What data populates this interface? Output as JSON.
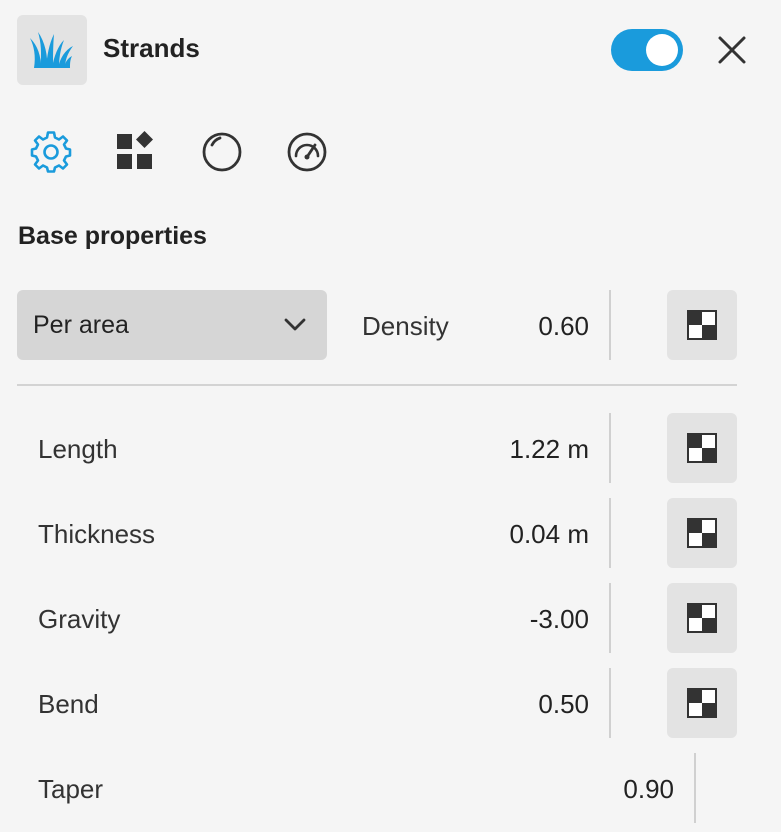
{
  "header": {
    "title": "Strands",
    "enabled": true,
    "accent_color": "#1a9bdc"
  },
  "tabs": [
    {
      "icon": "gear-icon",
      "active": true
    },
    {
      "icon": "shapes-icon",
      "active": false
    },
    {
      "icon": "circle-icon",
      "active": false
    },
    {
      "icon": "gauge-icon",
      "active": false
    }
  ],
  "section": {
    "title": "Base properties"
  },
  "distribution": {
    "selected": "Per area",
    "density_label": "Density",
    "density_value": "0.60"
  },
  "fields": [
    {
      "label": "Length",
      "value": "1.22 m"
    },
    {
      "label": "Thickness",
      "value": "0.04 m"
    },
    {
      "label": "Gravity",
      "value": "-3.00"
    },
    {
      "label": "Bend",
      "value": "0.50"
    },
    {
      "label": "Taper",
      "value": "0.90"
    }
  ]
}
